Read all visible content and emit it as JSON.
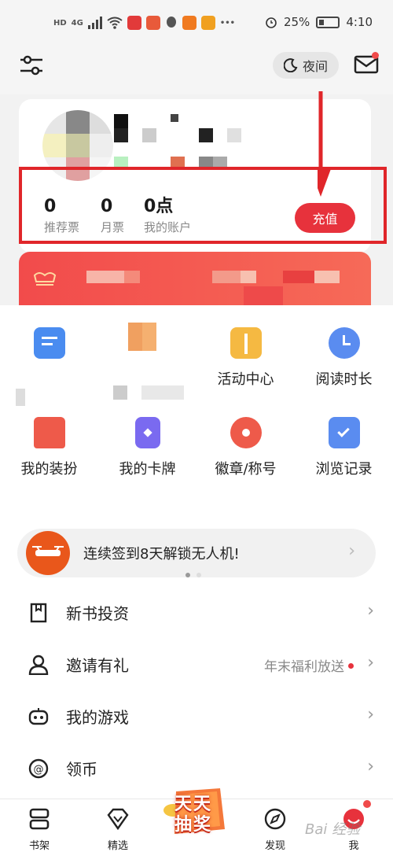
{
  "status_bar": {
    "net_label": "HD",
    "signal_label": "4G",
    "battery": "25%",
    "time": "4:10"
  },
  "header": {
    "night_mode_label": "夜间"
  },
  "account": {
    "stats": [
      {
        "value": "0",
        "label": "推荐票"
      },
      {
        "value": "0",
        "label": "月票"
      },
      {
        "value": "0点",
        "label": "我的账户"
      }
    ],
    "recharge_label": "充值"
  },
  "grid": {
    "items": [
      {
        "label": "",
        "icon": "message-icon",
        "color": "#4a8cf0"
      },
      {
        "label": "",
        "icon": "pixelated-icon",
        "color": "#f0a060"
      },
      {
        "label": "活动中心",
        "icon": "gift-icon",
        "color": "#f5b942"
      },
      {
        "label": "阅读时长",
        "icon": "clock-icon",
        "color": "#5a8cf0"
      },
      {
        "label": "我的装扮",
        "icon": "shirt-icon",
        "color": "#ee5a4a"
      },
      {
        "label": "我的卡牌",
        "icon": "cards-icon",
        "color": "#7a6af0"
      },
      {
        "label": "徽章/称号",
        "icon": "medal-icon",
        "color": "#ee5a4a"
      },
      {
        "label": "浏览记录",
        "icon": "history-icon",
        "color": "#5a8cf0"
      }
    ]
  },
  "promo": {
    "text": "连续签到8天解锁无人机!"
  },
  "menu": [
    {
      "label": "新书投资",
      "icon": "bookmark-icon",
      "extra": ""
    },
    {
      "label": "邀请有礼",
      "icon": "person-icon",
      "extra": "年末福利放送"
    },
    {
      "label": "我的游戏",
      "icon": "gamepad-icon",
      "extra": ""
    },
    {
      "label": "领币",
      "icon": "coin-icon",
      "extra": ""
    }
  ],
  "bottom_nav": [
    {
      "label": "书架",
      "icon": "bookshelf-icon"
    },
    {
      "label": "精选",
      "icon": "diamond-icon"
    },
    {
      "label": "发现",
      "icon": "compass-icon"
    },
    {
      "label": "我",
      "icon": "profile-icon"
    }
  ],
  "lottery": {
    "line1": "天天",
    "line2": "抽奖"
  },
  "watermark": "Bai 经验",
  "colors": {
    "accent_red": "#e7323c",
    "highlight_border": "#e0262a",
    "vip_gradient_start": "#f24b4b"
  }
}
